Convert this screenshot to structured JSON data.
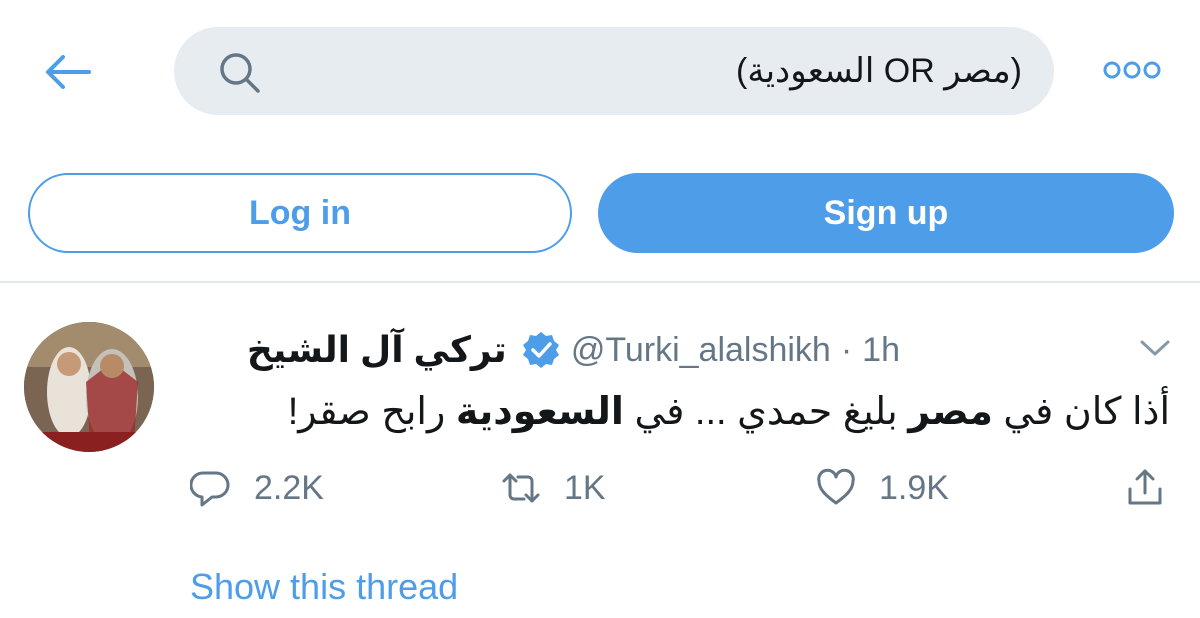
{
  "header": {
    "back_icon": "arrow-left-icon",
    "search": {
      "query": "(مصر OR السعودية)",
      "icon": "search-icon"
    },
    "more_icon": "more-dots-icon"
  },
  "auth": {
    "login_label": "Log in",
    "signup_label": "Sign up"
  },
  "tweet": {
    "display_name": "تركي آل الشيخ",
    "verified": true,
    "handle": "@Turki_alalshikh",
    "separator": "·",
    "time": "1h",
    "text_parts": [
      "أذا كان في ",
      "مصر",
      " بليغ حمدي ... في ",
      "السعودية",
      " رابح صقر!"
    ],
    "counts": {
      "replies": "2.2K",
      "retweets": "1K",
      "likes": "1.9K"
    },
    "show_thread": "Show this thread"
  },
  "colors": {
    "accent": "#4d9de9",
    "muted": "#657786",
    "search_bg": "#e6ecf0"
  }
}
